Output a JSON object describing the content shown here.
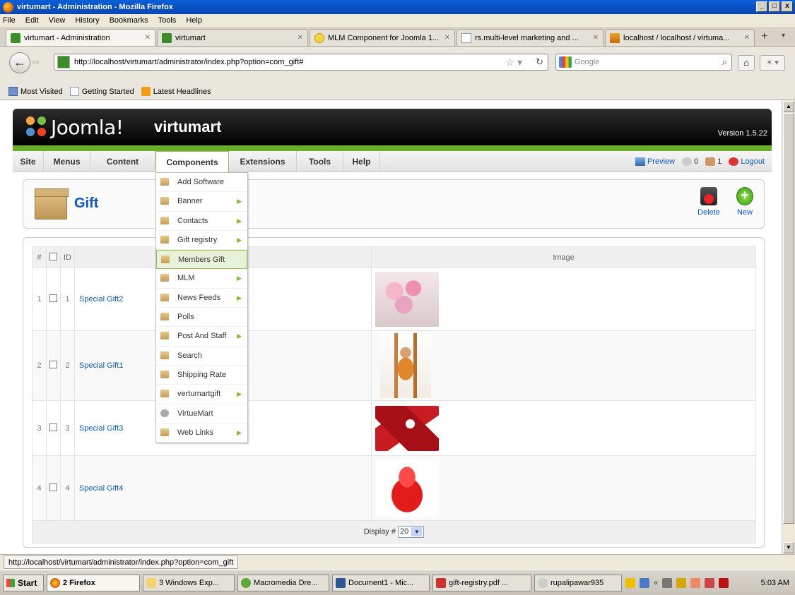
{
  "window": {
    "title": "virtumart - Administration - Mozilla Firefox",
    "controls": [
      "_",
      "□",
      "x"
    ]
  },
  "menubar": [
    "File",
    "Edit",
    "View",
    "History",
    "Bookmarks",
    "Tools",
    "Help"
  ],
  "tabs": [
    {
      "label": "virtumart - Administration",
      "active": true
    },
    {
      "label": "virtumart"
    },
    {
      "label": "MLM Component for Joomla 1..."
    },
    {
      "label": "rs.multi-level marketing and ..."
    },
    {
      "label": "localhost / localhost / virtuma..."
    }
  ],
  "nav": {
    "url": "http://localhost/virtumart/administrator/index.php?option=com_gift#",
    "search_placeholder": "Google"
  },
  "bookmarks": [
    "Most Visited",
    "Getting Started",
    "Latest Headlines"
  ],
  "joomla": {
    "brand": "Joomla!",
    "site_name": "virtumart",
    "version": "Version 1.5.22",
    "menu": [
      "Site",
      "Menus",
      "Content",
      "Components",
      "Extensions",
      "Tools",
      "Help"
    ],
    "right": {
      "preview": "Preview",
      "messages": "0",
      "users": "1",
      "logout": "Logout"
    }
  },
  "toolbar": {
    "title": "Gift",
    "delete_label": "Delete",
    "new_label": "New"
  },
  "components_menu": [
    {
      "label": "Add Software",
      "sub": false
    },
    {
      "label": "Banner",
      "sub": true
    },
    {
      "label": "Contacts",
      "sub": true
    },
    {
      "label": "Gift registry",
      "sub": true
    },
    {
      "label": "Members Gift",
      "sub": false,
      "highlighted": true
    },
    {
      "label": "MLM",
      "sub": true
    },
    {
      "label": "News Feeds",
      "sub": true
    },
    {
      "label": "Polls",
      "sub": false
    },
    {
      "label": "Post And Staff",
      "sub": true
    },
    {
      "label": "Search",
      "sub": false
    },
    {
      "label": "Shipping Rate",
      "sub": false
    },
    {
      "label": "vertumartgift",
      "sub": true
    },
    {
      "label": "VirtueMart",
      "sub": false
    },
    {
      "label": "Web Links",
      "sub": true
    }
  ],
  "table": {
    "headers": {
      "num": "#",
      "id": "ID",
      "name_tail": "e",
      "image": "Image"
    },
    "rows": [
      {
        "num": "1",
        "id": "1",
        "name": "Special Gift2"
      },
      {
        "num": "2",
        "id": "2",
        "name": "Special Gift1"
      },
      {
        "num": "3",
        "id": "3",
        "name": "Special Gift3"
      },
      {
        "num": "4",
        "id": "4",
        "name": "Special Gift4"
      }
    ],
    "footer": {
      "display_label": "Display #",
      "display_value": "20"
    }
  },
  "status": {
    "url": "http://localhost/virtumart/administrator/index.php?option=com_gift"
  },
  "taskbar": {
    "start": "Start",
    "items": [
      "2 Firefox",
      "3 Windows Exp...",
      "Macromedia Dre...",
      "Document1 - Mic...",
      "gift-registry.pdf ...",
      "rupalipawar935"
    ],
    "clock": "5:03 AM"
  },
  "colors": {
    "joomla_green": "#6aad2a",
    "link_blue": "#0b55c4",
    "xp_title": "#0a5fd8"
  }
}
